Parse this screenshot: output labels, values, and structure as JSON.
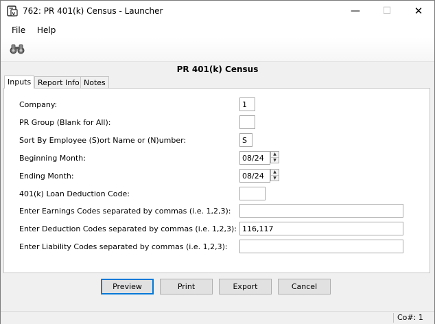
{
  "window": {
    "title": "762: PR 401(k) Census - Launcher",
    "minimize_icon": "minimize-icon",
    "maximize_icon": "maximize-icon",
    "close_icon": "close-icon"
  },
  "menu": {
    "items": [
      "File",
      "Help"
    ]
  },
  "toolbar": {
    "find_icon": "binoculars-icon"
  },
  "form": {
    "title": "PR 401(k) Census",
    "tabs": [
      "Inputs",
      "Report Info",
      "Notes"
    ],
    "active_tab": "Inputs",
    "fields": {
      "company": {
        "label": "Company:",
        "value": "1"
      },
      "pr_group": {
        "label": "PR Group (Blank for All):",
        "value": ""
      },
      "sort_by": {
        "label": "Sort By Employee (S)ort Name or (N)umber:",
        "value": "S"
      },
      "beginning_month": {
        "label": "Beginning Month:",
        "value": "08/24"
      },
      "ending_month": {
        "label": "Ending Month:",
        "value": "08/24"
      },
      "loan_code": {
        "label": "401(k) Loan Deduction Code:",
        "value": ""
      },
      "earnings_codes": {
        "label": "Enter Earnings Codes separated by commas (i.e. 1,2,3):",
        "value": ""
      },
      "deduction_codes": {
        "label": "Enter Deduction Codes separated by commas (i.e. 1,2,3):",
        "value": "116,117"
      },
      "liability_codes": {
        "label": "Enter Liability Codes separated by commas (i.e. 1,2,3):",
        "value": ""
      }
    }
  },
  "buttons": {
    "preview": "Preview",
    "print": "Print",
    "export": "Export",
    "cancel": "Cancel"
  },
  "status": {
    "company": "Co#: 1"
  }
}
